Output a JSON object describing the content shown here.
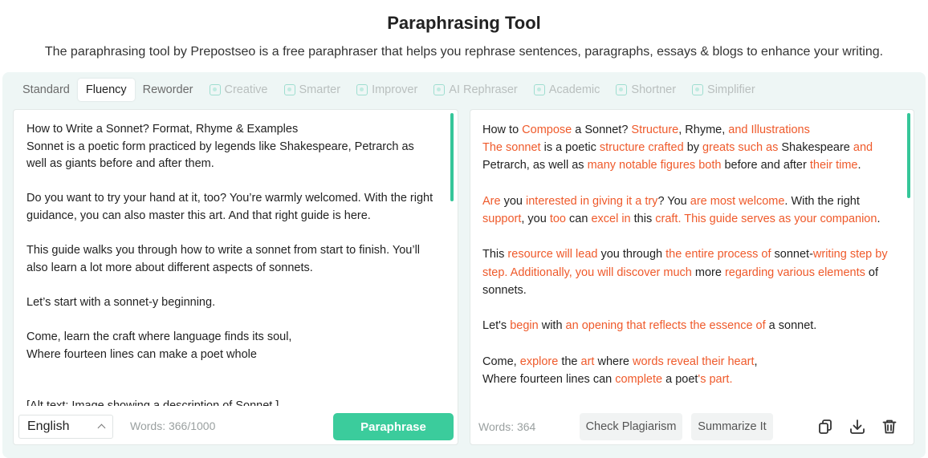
{
  "header": {
    "title": "Paraphrasing Tool",
    "subtitle": "The paraphrasing tool by Prepostseo is a free paraphraser that helps you rephrase sentences, paragraphs, essays & blogs to enhance your writing."
  },
  "modes": [
    {
      "label": "Standard",
      "state": "normal",
      "icon": ""
    },
    {
      "label": "Fluency",
      "state": "active",
      "icon": ""
    },
    {
      "label": "Reworder",
      "state": "normal",
      "icon": ""
    },
    {
      "label": "Creative",
      "state": "locked",
      "icon": "creative-icon"
    },
    {
      "label": "Smarter",
      "state": "locked",
      "icon": "smarter-icon"
    },
    {
      "label": "Improver",
      "state": "locked",
      "icon": "improver-icon"
    },
    {
      "label": "AI Rephraser",
      "state": "locked",
      "icon": "ai-rephraser-icon"
    },
    {
      "label": "Academic",
      "state": "locked",
      "icon": "academic-icon"
    },
    {
      "label": "Shortner",
      "state": "locked",
      "icon": "shortner-icon"
    },
    {
      "label": "Simplifier",
      "state": "locked",
      "icon": "simplifier-icon"
    }
  ],
  "input": {
    "paragraphs": [
      "How to Write a Sonnet? Format, Rhyme & Examples\nSonnet is a poetic form practiced by legends like Shakespeare, Petrarch as well as giants before and after them.",
      "Do you want to try your hand at it, too? You’re warmly welcomed. With the right guidance, you can also master this art. And that right guide is here.",
      "This guide walks you through how to write a sonnet from start to finish. You’ll also learn a lot more about different aspects of sonnets.",
      "Let’s start with a sonnet-y beginning.",
      "Come, learn the craft where language finds its soul,\nWhere fourteen lines can make a poet whole",
      "[Alt text: Image showing a description of Sonnet.]"
    ],
    "language": "English",
    "word_count": "Words: 366/1000",
    "paraphrase_label": "Paraphrase"
  },
  "output": {
    "paragraphs": [
      [
        {
          "t": "How to ",
          "c": false
        },
        {
          "t": "Compose",
          "c": true
        },
        {
          "t": " a Sonnet? ",
          "c": false
        },
        {
          "t": "Structure",
          "c": true
        },
        {
          "t": ", Rhyme, ",
          "c": false
        },
        {
          "t": "and Illustrations",
          "c": true
        },
        {
          "t": "\n",
          "c": false
        },
        {
          "t": "The sonnet",
          "c": true
        },
        {
          "t": " is a poetic ",
          "c": false
        },
        {
          "t": "structure crafted",
          "c": true
        },
        {
          "t": " by ",
          "c": false
        },
        {
          "t": "greats such as",
          "c": true
        },
        {
          "t": " Shakespeare ",
          "c": false
        },
        {
          "t": "and",
          "c": true
        },
        {
          "t": " Petrarch, as well as ",
          "c": false
        },
        {
          "t": "many notable figures both",
          "c": true
        },
        {
          "t": " before and after ",
          "c": false
        },
        {
          "t": "their time",
          "c": true
        },
        {
          "t": ".",
          "c": false
        }
      ],
      [
        {
          "t": "Are",
          "c": true
        },
        {
          "t": " you ",
          "c": false
        },
        {
          "t": "interested in giving it a try",
          "c": true
        },
        {
          "t": "? You ",
          "c": false
        },
        {
          "t": "are most welcome",
          "c": true
        },
        {
          "t": ". With the right ",
          "c": false
        },
        {
          "t": "support",
          "c": true
        },
        {
          "t": ", you ",
          "c": false
        },
        {
          "t": "too",
          "c": true
        },
        {
          "t": " can ",
          "c": false
        },
        {
          "t": "excel in",
          "c": true
        },
        {
          "t": " this ",
          "c": false
        },
        {
          "t": "craft. This guide serves as your companion",
          "c": true
        },
        {
          "t": ".",
          "c": false
        }
      ],
      [
        {
          "t": "This ",
          "c": false
        },
        {
          "t": "resource will lead",
          "c": true
        },
        {
          "t": " you through ",
          "c": false
        },
        {
          "t": "the entire process of",
          "c": true
        },
        {
          "t": " sonnet-",
          "c": false
        },
        {
          "t": "writing step by step. Additionally, you will discover much",
          "c": true
        },
        {
          "t": " more ",
          "c": false
        },
        {
          "t": "regarding various elements",
          "c": true
        },
        {
          "t": " of sonnets.",
          "c": false
        }
      ],
      [
        {
          "t": "Let's ",
          "c": false
        },
        {
          "t": "begin",
          "c": true
        },
        {
          "t": " with ",
          "c": false
        },
        {
          "t": "an opening that reflects the essence of",
          "c": true
        },
        {
          "t": " a sonnet.",
          "c": false
        }
      ],
      [
        {
          "t": "Come, ",
          "c": false
        },
        {
          "t": "explore",
          "c": true
        },
        {
          "t": " the ",
          "c": false
        },
        {
          "t": "art",
          "c": true
        },
        {
          "t": " where ",
          "c": false
        },
        {
          "t": "words reveal their heart",
          "c": true
        },
        {
          "t": ",\n",
          "c": false
        },
        {
          "t": "Where fourteen lines can ",
          "c": false
        },
        {
          "t": "complete",
          "c": true
        },
        {
          "t": " a poet",
          "c": false
        },
        {
          "t": "'s part.",
          "c": true
        }
      ]
    ],
    "word_count": "Words: 364",
    "check_plagiarism_label": "Check Plagiarism",
    "summarize_label": "Summarize It"
  },
  "colors": {
    "accent": "#3bcc9c",
    "changed_text": "#ef5a2b",
    "panel_bg": "#eef6f5"
  }
}
